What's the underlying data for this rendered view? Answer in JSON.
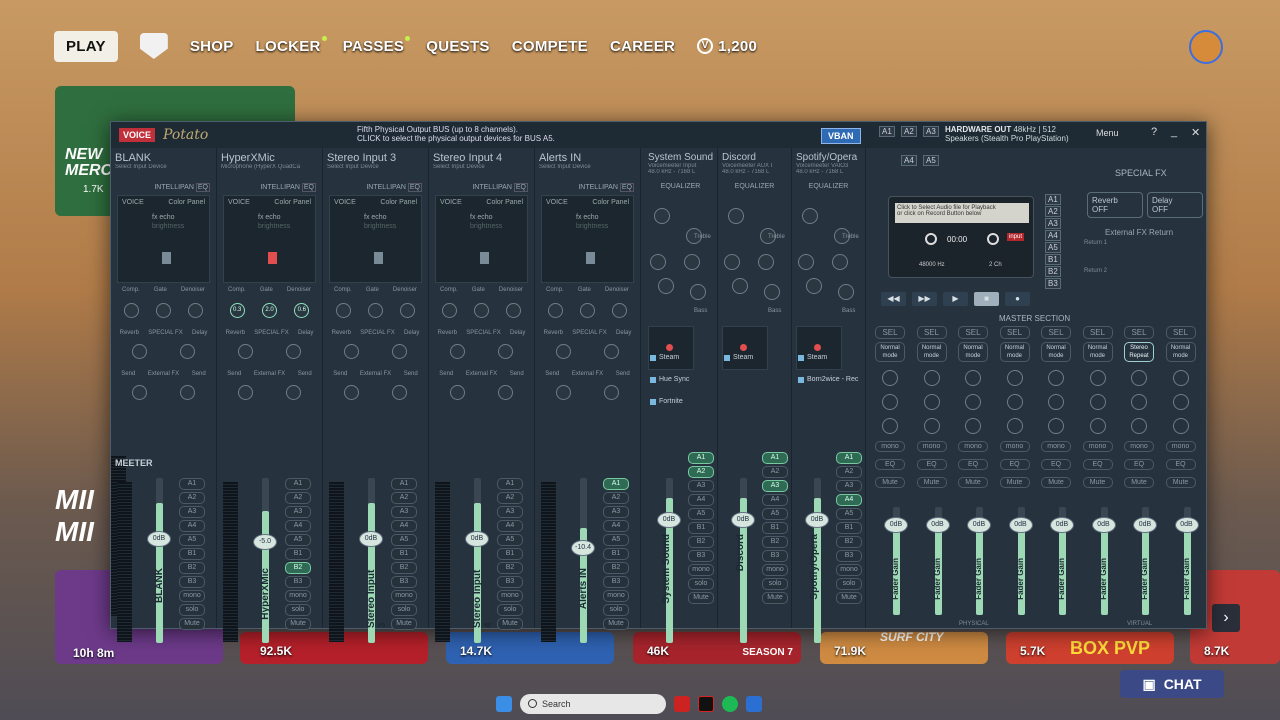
{
  "nav": {
    "play": "PLAY",
    "shop": "SHOP",
    "locker": "LOCKER",
    "passes": "PASSES",
    "quests": "QUESTS",
    "compete": "COMPETE",
    "career": "CAREER",
    "vbucks": "1,200"
  },
  "promo": {
    "title_a": "NEW",
    "title_b": "MERC",
    "count": "1.7K"
  },
  "side_text": {
    "line1": "MII",
    "line2": "MII"
  },
  "tiles": [
    {
      "label": "10h 8m"
    },
    {
      "label": "92.5K"
    },
    {
      "label": "14.7K"
    },
    {
      "label": "46K",
      "badge": "SEASON 7"
    },
    {
      "label": "71.9K",
      "title": "SURF CITY"
    },
    {
      "label": "5.7K",
      "title": "BOX PVP"
    },
    {
      "label": "8.7K"
    }
  ],
  "chat": "CHAT",
  "taskbar": {
    "search_placeholder": "Search"
  },
  "mixer": {
    "voice": "VOICE",
    "meter": "MEETER",
    "brand": "Potato",
    "header_line1": "Fifth Physical Output BUS (up to 8 channels).",
    "header_line2": "CLICK to select the physical output devices for BUS A5.",
    "vban": "VBAN",
    "hw_title": "HARDWARE OUT",
    "hw_rate": "48kHz | 512",
    "hw_device": "Speakers (Stealth Pro PlayStation)",
    "menu": "Menu",
    "buttons_top": [
      "A1",
      "A2",
      "A3",
      "A4",
      "A5"
    ],
    "inputs": [
      {
        "name": "BLANK",
        "sub": "Select Input Device",
        "fader": "0dB",
        "label": "BLANK"
      },
      {
        "name": "HyperXMic",
        "sub": "Microphone (HyperX QuadCa",
        "fader": "-5.0",
        "label": "HyperXMic"
      },
      {
        "name": "Stereo Input 3",
        "sub": "Select Input Device",
        "fader": "0dB",
        "label": "Stereo Input 3"
      },
      {
        "name": "Stereo Input 4",
        "sub": "Select Input Device",
        "fader": "0dB",
        "label": "Stereo Input 4"
      },
      {
        "name": "Alerts IN",
        "sub": "Select Input Device",
        "fader": "-10.4",
        "label": "Alerts IN"
      }
    ],
    "virtual": [
      {
        "name": "System Sound",
        "sub": "Voicemeeter Input",
        "rate": "48.0 kHz - 7168 L",
        "fader": "0dB",
        "label": "System Sound"
      },
      {
        "name": "Discord",
        "sub": "Voicemeeter AUX I",
        "rate": "48.0 kHz - 7168 L",
        "fader": "0dB",
        "label": "Discord"
      },
      {
        "name": "Spotify/Opera",
        "sub": "Voicemeeter VAIO3",
        "rate": "48.0 kHz - 7168 L",
        "fader": "0dB",
        "label": "Spotify/Opera"
      }
    ],
    "strip_labels": {
      "intellipan": "INTELLIPAN",
      "eq": "EQ",
      "voice": "VOICE",
      "color": "Color Panel",
      "fxecho": "fx echo",
      "bright": "brightness",
      "comp": "Comp.",
      "gate": "Gate",
      "denoiser": "Denoiser",
      "reverb": "Reverb",
      "special": "SPECIAL FX",
      "delay": "Delay",
      "send": "Send",
      "external": "External FX",
      "equalizer": "EQUALIZER",
      "treble": "Treble",
      "bass": "Bass"
    },
    "hyperx_knobs": [
      "0.3",
      "2.0",
      "0.6"
    ],
    "bus_buttons": [
      "A1",
      "A2",
      "A3",
      "A4",
      "A5",
      "B1",
      "B2",
      "B3",
      "mono",
      "solo",
      "Mute"
    ],
    "apps": [
      {
        "name": "Steam"
      },
      {
        "name": "Hue Sync"
      },
      {
        "name": "Fortnite"
      },
      {
        "name": "Steam"
      },
      {
        "name": "Steam"
      },
      {
        "name": "Born2wice - Rec"
      }
    ],
    "tape": {
      "line1": "Click to Select Audio file for Playback",
      "line2": "or click on Record Button below",
      "time": "00:00",
      "rate": "48000 Hz",
      "ch": "2 Ch",
      "input": "input"
    },
    "fx": {
      "title": "SPECIAL FX",
      "reverb": "Reverb",
      "reverb_state": "OFF",
      "delay": "Delay",
      "delay_state": "OFF",
      "ext_return": "External FX Return",
      "return1": "Return 1",
      "return2": "Return 2"
    },
    "master": {
      "title": "MASTER SECTION",
      "sel": "SEL",
      "mode": "Normal mode",
      "mode_special": "Stereo Repeat",
      "fader_label": "Fader Gain",
      "db": "0dB",
      "physical": "PHYSICAL",
      "virtual": "VIRTUAL"
    },
    "master_buses": [
      "A1",
      "A2",
      "A3",
      "A4",
      "A5",
      "B1",
      "B2",
      "B3"
    ]
  }
}
